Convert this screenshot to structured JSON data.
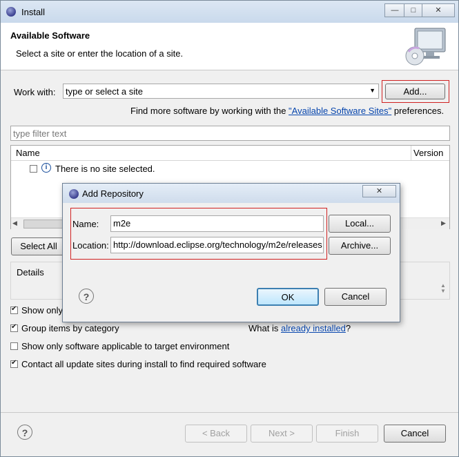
{
  "window": {
    "title": "Install",
    "controls": [
      "—",
      "□",
      "✕"
    ]
  },
  "header": {
    "title": "Available Software",
    "subtitle": "Select a site or enter the location of a site."
  },
  "work_with": {
    "label": "Work with:",
    "combo_value": "type or select a site",
    "add_button": "Add...",
    "find_more_prefix": "Find more software by working with the ",
    "find_more_link": "\"Available Software Sites\"",
    "find_more_suffix": " preferences."
  },
  "filter": {
    "placeholder": "type filter text"
  },
  "table": {
    "columns": [
      "Name",
      "Version"
    ],
    "rows": [
      {
        "checked": false,
        "text": "There is no site selected."
      }
    ]
  },
  "select_all_button": "Select All",
  "details_label": "Details",
  "options": [
    {
      "label": "Show only",
      "checked": true
    },
    {
      "label": "Group items by category",
      "checked": true
    },
    {
      "label": "Show only software applicable to target environment",
      "checked": false
    },
    {
      "label": "Contact all update sites during install to find required software",
      "checked": true
    }
  ],
  "installed": {
    "prefix": "What is ",
    "link": "already installed",
    "suffix": "?"
  },
  "footer": {
    "back": "< Back",
    "next": "Next >",
    "finish": "Finish",
    "cancel": "Cancel"
  },
  "dialog": {
    "title": "Add Repository",
    "close": "✕",
    "name_label": "Name:",
    "name_value": "m2e",
    "location_label": "Location:",
    "location_value": "http://download.eclipse.org/technology/m2e/releases",
    "local_button": "Local...",
    "archive_button": "Archive...",
    "ok_button": "OK",
    "cancel_button": "Cancel"
  },
  "colors": {
    "highlight_border": "#d02020",
    "link": "#0645ad"
  }
}
